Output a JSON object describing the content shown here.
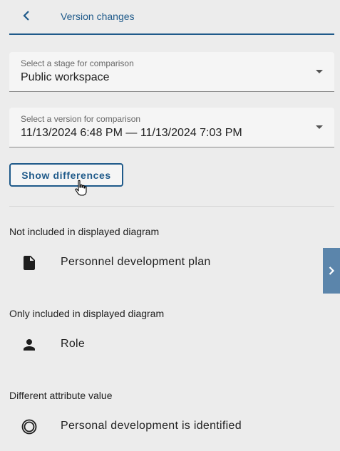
{
  "header": {
    "title": "Version changes",
    "back_icon": "chevron-left-icon"
  },
  "stage_select": {
    "label": "Select a stage for comparison",
    "value": "Public workspace"
  },
  "version_select": {
    "label": "Select a version for comparison",
    "value": "11/13/2024 6:48 PM — 11/13/2024 7:03 PM"
  },
  "show_differences_label": "Show differences",
  "sections": {
    "not_included": {
      "title": "Not included in displayed diagram",
      "item_label": "Personnel development plan",
      "item_icon": "document-icon"
    },
    "only_included": {
      "title": "Only included in displayed diagram",
      "item_label": "Role",
      "item_icon": "person-icon"
    },
    "different_attribute": {
      "title": "Different attribute value",
      "item_label": "Personal development is identified",
      "item_icon": "event-circle-icon"
    }
  },
  "side_panel_toggle_icon": "chevron-right-icon",
  "colors": {
    "accent": "#1f5a8a",
    "background": "#ececec",
    "side_tab": "#5b85ab"
  }
}
